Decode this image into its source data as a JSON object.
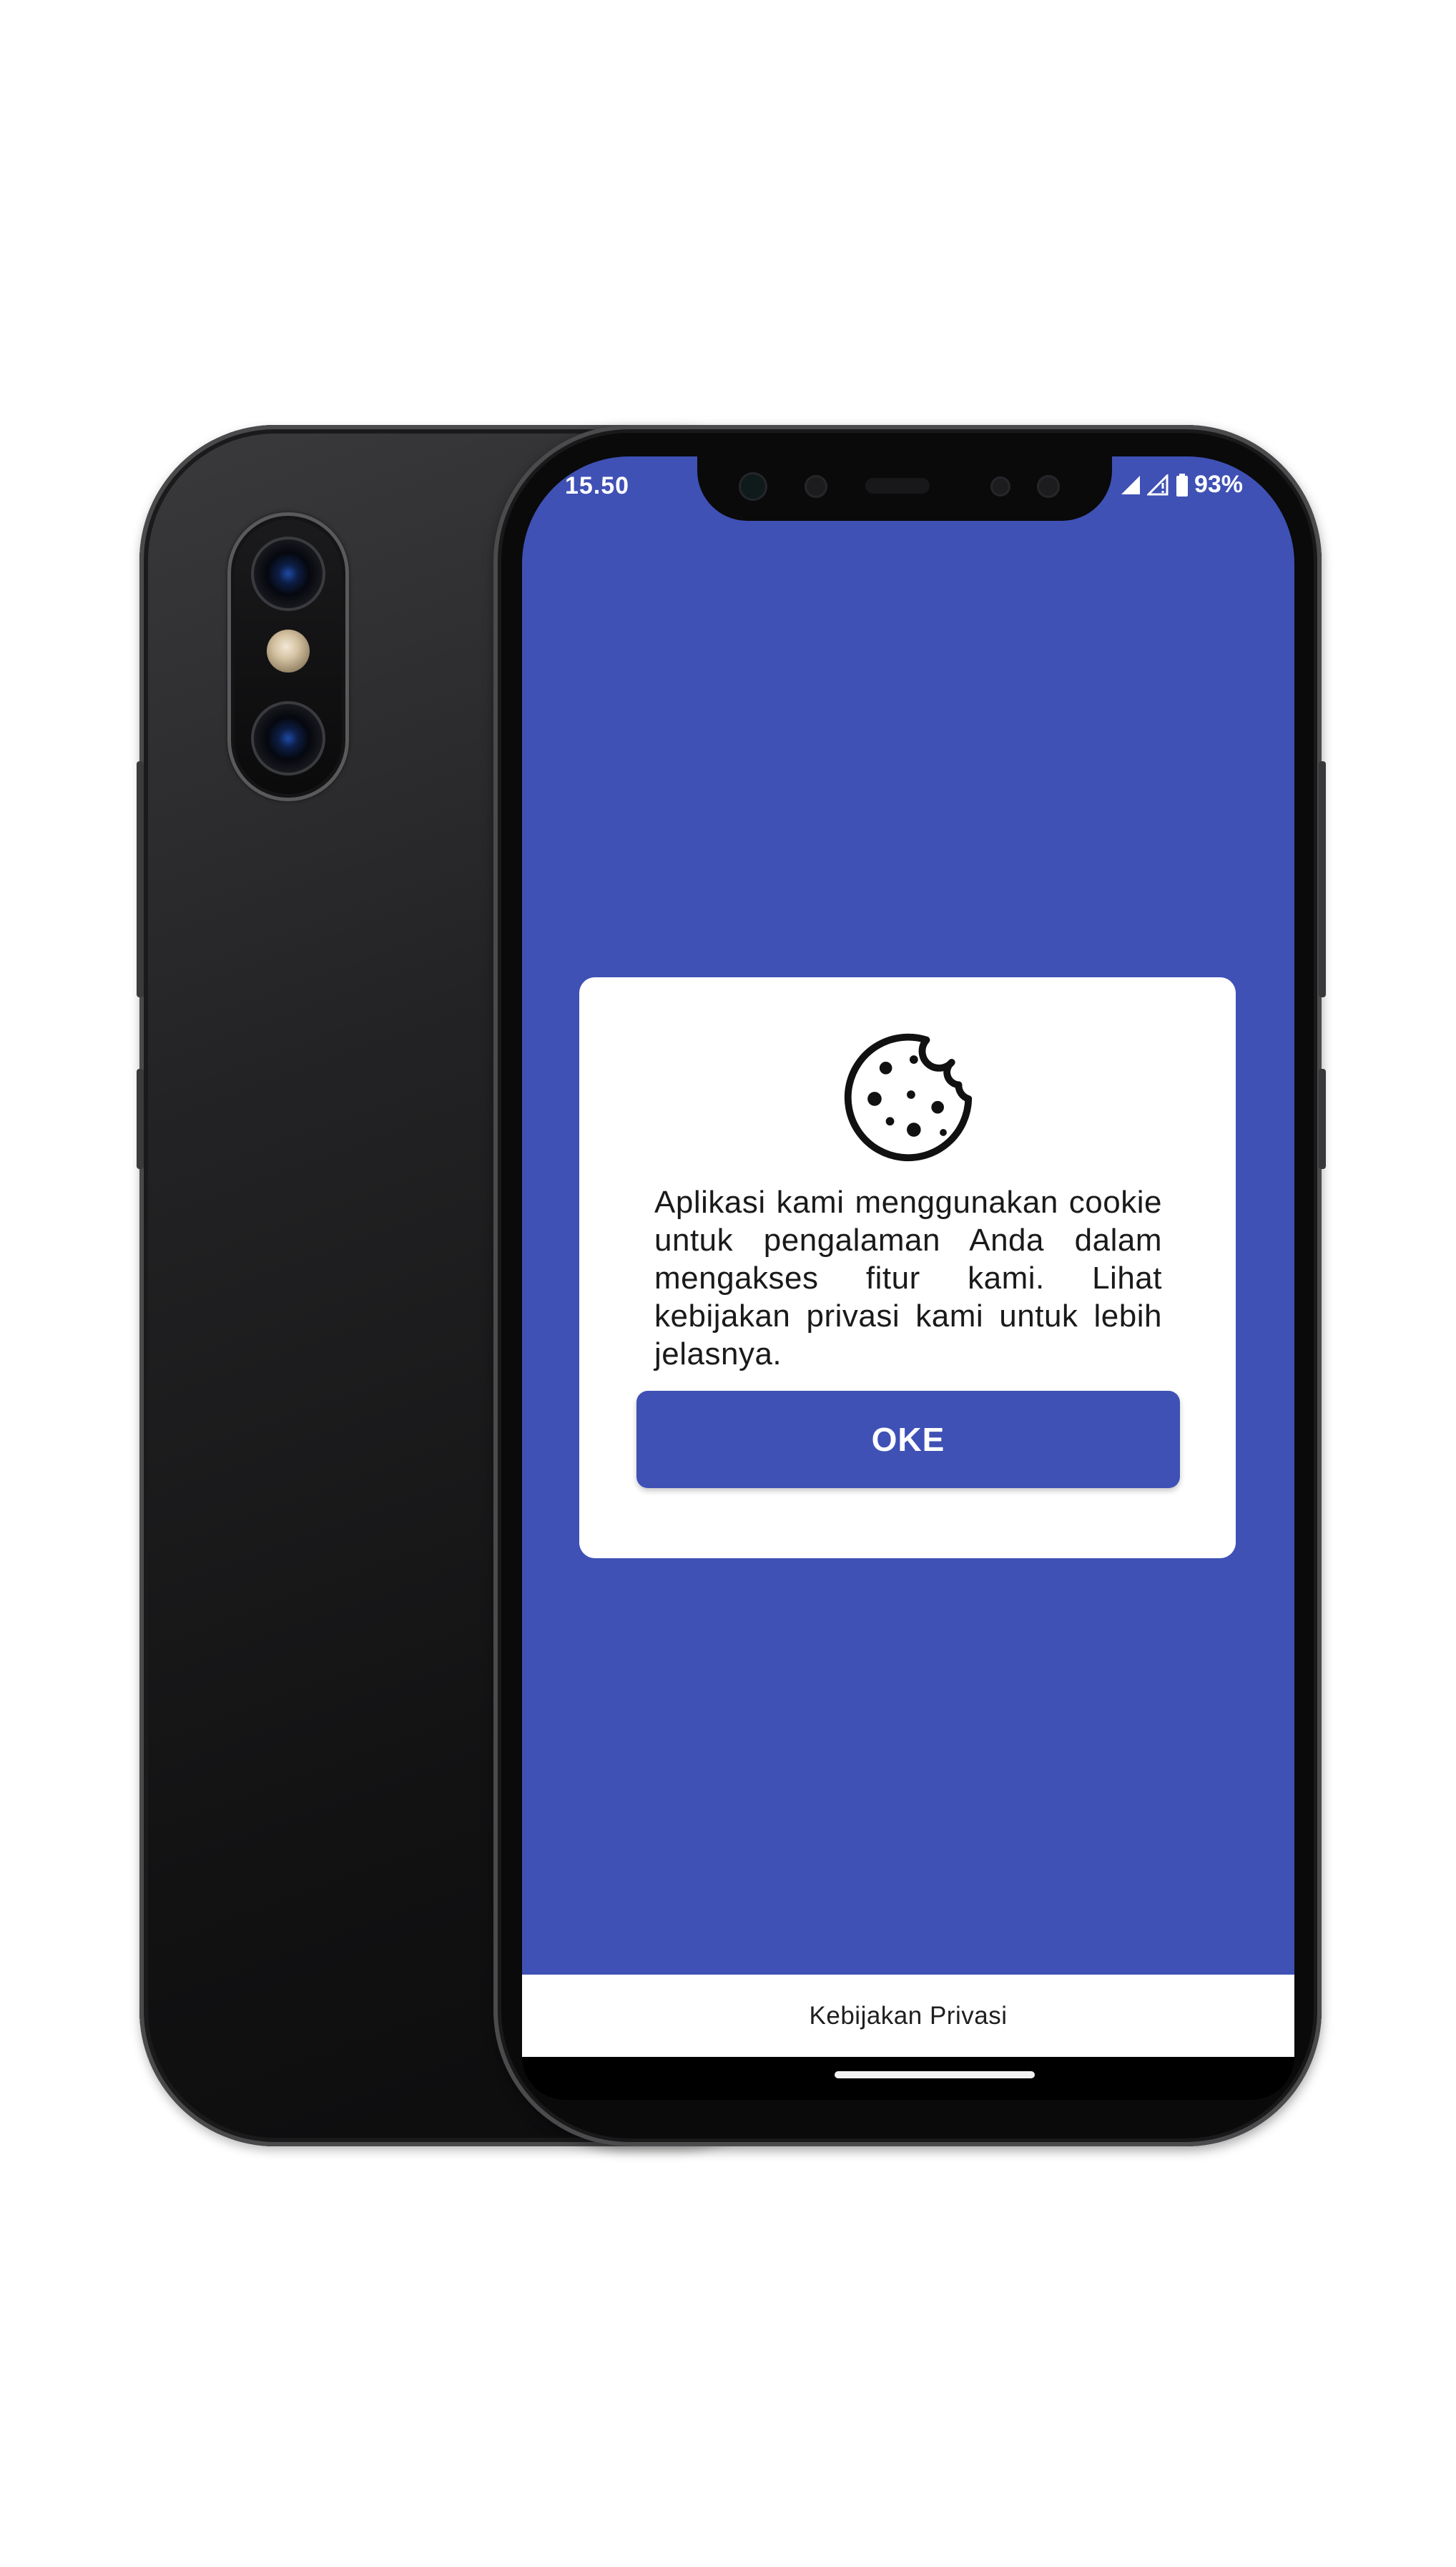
{
  "status_bar": {
    "time": "15.50",
    "battery": "93%"
  },
  "dialog": {
    "icon": "cookie-icon",
    "message": "Aplikasi kami menggunakan cookie untuk pengalaman Anda dalam mengakses fitur kami. Lihat kebijakan privasi kami untuk lebih jelasnya.",
    "ok_label": "OKE"
  },
  "footer": {
    "privacy_link": "Kebijakan Privasi"
  },
  "colors": {
    "primary": "#3f51b5",
    "dialog_background": "#ffffff",
    "footer_background": "#ffffff"
  }
}
